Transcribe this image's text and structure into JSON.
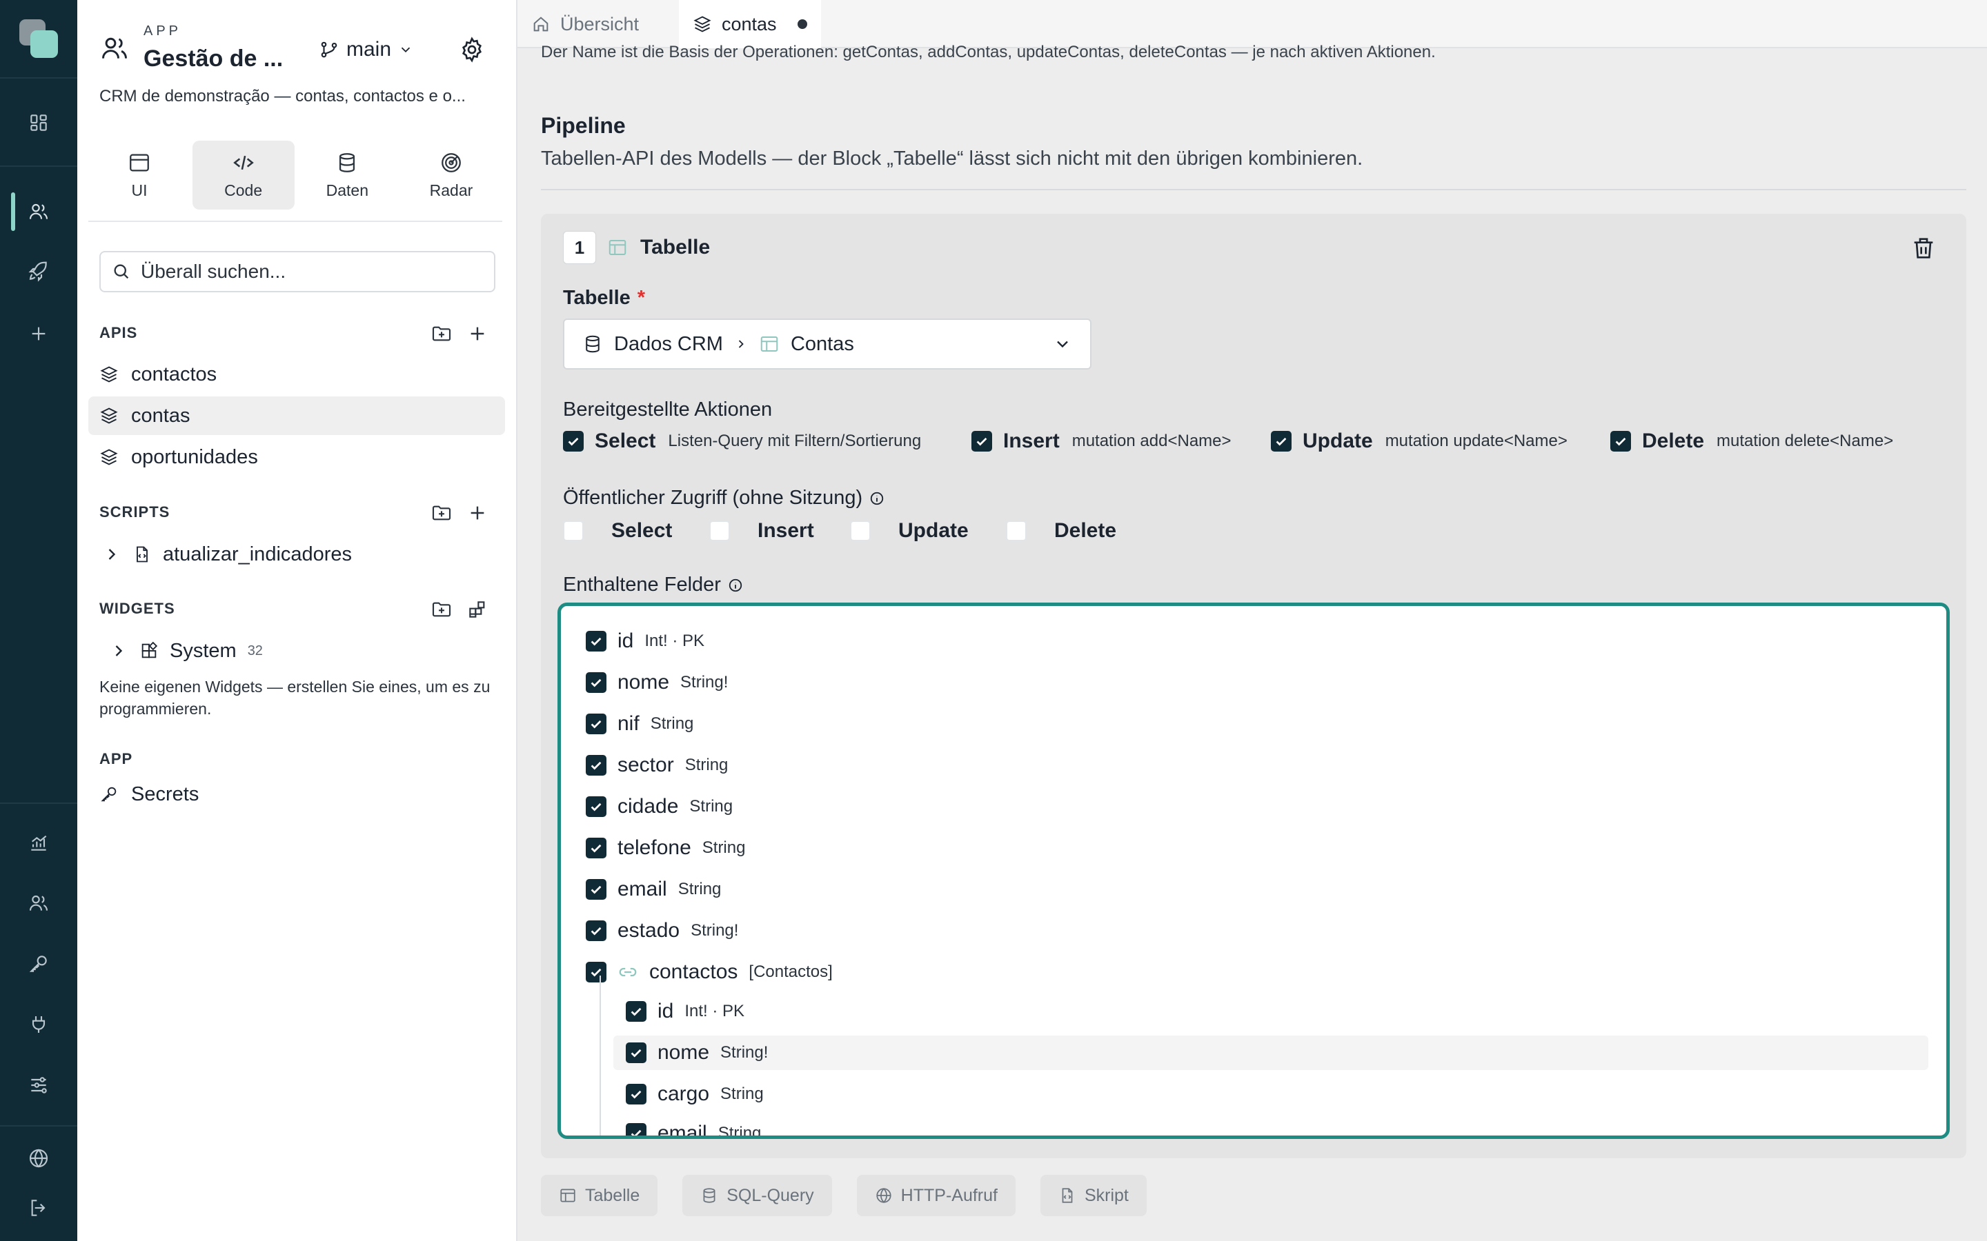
{
  "app": {
    "kicker": "APP",
    "title": "Gestão de ...",
    "branch": "main",
    "description": "CRM de demonstração — contas, contactos e o..."
  },
  "mode_tabs": [
    {
      "label": "UI",
      "icon": "browser-window-icon"
    },
    {
      "label": "Code",
      "icon": "code-icon",
      "active": true
    },
    {
      "label": "Daten",
      "icon": "database-icon"
    },
    {
      "label": "Radar",
      "icon": "radar-icon"
    }
  ],
  "search": {
    "placeholder": "Überall suchen..."
  },
  "sidebar": {
    "apis": {
      "title": "APIS",
      "items": [
        {
          "label": "contactos"
        },
        {
          "label": "contas",
          "active": true
        },
        {
          "label": "oportunidades"
        }
      ]
    },
    "scripts": {
      "title": "SCRIPTS",
      "items": [
        {
          "label": "atualizar_indicadores"
        }
      ]
    },
    "widgets": {
      "title": "WIDGETS",
      "items": [
        {
          "label": "System",
          "count": "32"
        }
      ],
      "note": "Keine eigenen Widgets — erstellen Sie eines, um es zu programmieren."
    },
    "app": {
      "title": "APP",
      "items": [
        {
          "label": "Secrets"
        }
      ]
    }
  },
  "tabs": [
    {
      "label": "Übersicht",
      "icon": "home-icon"
    },
    {
      "label": "contas",
      "icon": "layers-icon",
      "active": true,
      "unsaved": true
    }
  ],
  "main": {
    "top_note": "Der Name ist die Basis der Operationen: getContas, addContas, updateContas, deleteContas — je nach aktiven Aktionen.",
    "pipeline_title": "Pipeline",
    "pipeline_sub": "Tabellen-API des Modells — der Block „Tabelle“ lässt sich nicht mit den übrigen kombinieren."
  },
  "step": {
    "number": "1",
    "title": "Tabelle",
    "table_label": "Tabelle",
    "required_mark": "*",
    "source": "Dados CRM",
    "table": "Contas",
    "actions_label": "Bereitgestellte Aktionen",
    "actions": [
      {
        "name": "Select",
        "hint": "Listen-Query mit Filtern/Sortierung",
        "checked": true
      },
      {
        "name": "Insert",
        "hint": "mutation add<Name>",
        "checked": true
      },
      {
        "name": "Update",
        "hint": "mutation update<Name>",
        "checked": true
      },
      {
        "name": "Delete",
        "hint": "mutation delete<Name>",
        "checked": true
      }
    ],
    "public_label": "Öffentlicher Zugriff (ohne Sitzung)",
    "public": [
      {
        "name": "Select",
        "checked": false
      },
      {
        "name": "Insert",
        "checked": false
      },
      {
        "name": "Update",
        "checked": false
      },
      {
        "name": "Delete",
        "checked": false
      }
    ],
    "fields_label": "Enthaltene Felder",
    "fields": [
      {
        "name": "id",
        "type": "Int! · PK"
      },
      {
        "name": "nome",
        "type": "String!"
      },
      {
        "name": "nif",
        "type": "String"
      },
      {
        "name": "sector",
        "type": "String"
      },
      {
        "name": "cidade",
        "type": "String"
      },
      {
        "name": "telefone",
        "type": "String"
      },
      {
        "name": "email",
        "type": "String"
      },
      {
        "name": "estado",
        "type": "String!"
      },
      {
        "name": "contactos",
        "type": "[Contactos]",
        "relation": true
      }
    ],
    "nested_fields": [
      {
        "name": "id",
        "type": "Int! · PK"
      },
      {
        "name": "nome",
        "type": "String!"
      },
      {
        "name": "cargo",
        "type": "String"
      },
      {
        "name": "email",
        "type": "String"
      }
    ]
  },
  "block_types": [
    {
      "label": "Tabelle",
      "icon": "table-icon"
    },
    {
      "label": "SQL-Query",
      "icon": "database-icon"
    },
    {
      "label": "HTTP-Aufruf",
      "icon": "globe-icon"
    },
    {
      "label": "Skript",
      "icon": "script-file-icon"
    }
  ],
  "colors": {
    "rail": "#102a36",
    "accent": "#8fd4c8",
    "focus": "#1f8c84",
    "checkbox": "#102a36"
  }
}
